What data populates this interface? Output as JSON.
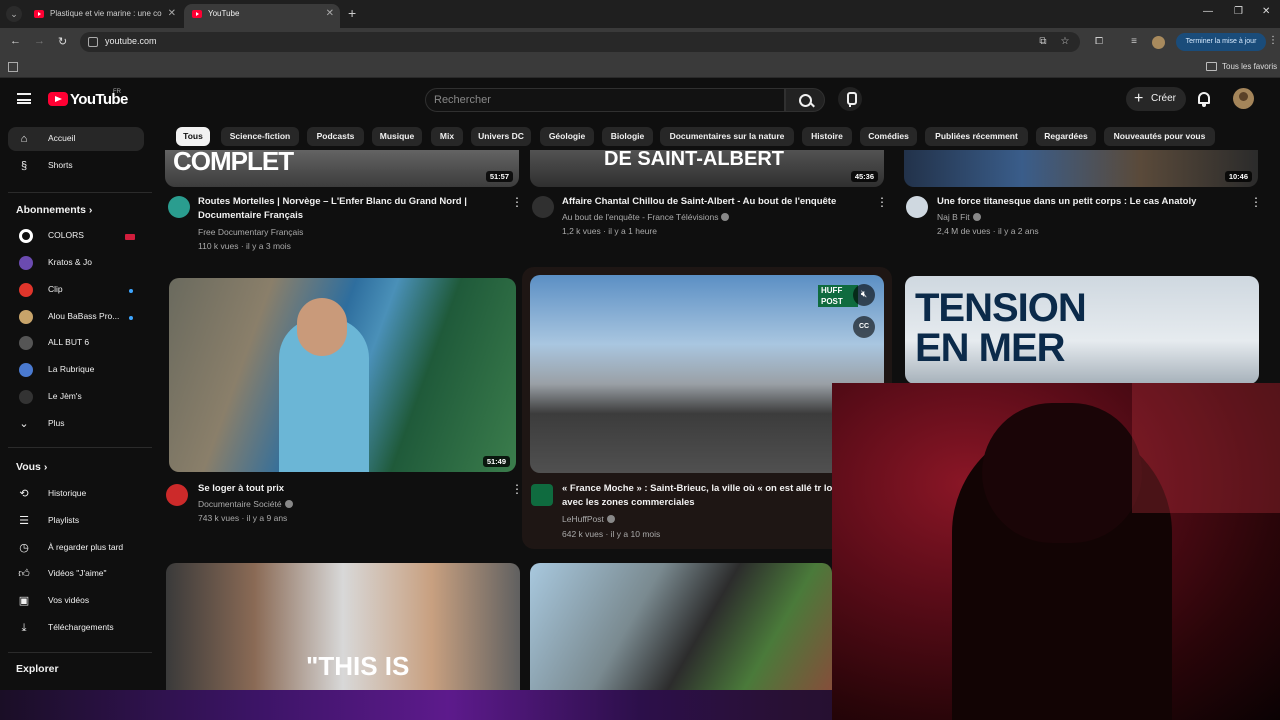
{
  "browser": {
    "tabs": [
      {
        "title": "Plastique et vie marine : une co"
      },
      {
        "title": "YouTube"
      }
    ],
    "url": "youtube.com",
    "update_button": "Terminer la mise à jour",
    "bookmarks_folder": "Tous les favoris"
  },
  "header": {
    "logo_text": "YouTube",
    "country": "FR",
    "search_placeholder": "Rechercher",
    "create_label": "Créer"
  },
  "chips": [
    "Tous",
    "Science-fiction",
    "Podcasts",
    "Musique",
    "Mix",
    "Univers DC",
    "Géologie",
    "Biologie",
    "Documentaires sur la nature",
    "Histoire",
    "Comédies",
    "Publiées récemment",
    "Regardées",
    "Nouveautés pour vous"
  ],
  "sidebar": {
    "main": [
      {
        "label": "Accueil",
        "icon": "home-icon"
      },
      {
        "label": "Shorts",
        "icon": "shorts-icon"
      }
    ],
    "subscriptions_title": "Abonnements",
    "subscriptions": [
      {
        "label": "COLORS",
        "color": "#ffffff"
      },
      {
        "label": "Kratos & Jo",
        "color": "#6b4bb0"
      },
      {
        "label": "Clip",
        "color": "#e0352b"
      },
      {
        "label": "Alou BaBass Pro...",
        "color": "#c8a46a"
      },
      {
        "label": "ALL BUT 6",
        "color": "#555555"
      },
      {
        "label": "La Rubrique",
        "color": "#4a7ad0"
      },
      {
        "label": "Le Jèm's",
        "color": "#333333"
      }
    ],
    "more_label": "Plus",
    "you_title": "Vous",
    "you_items": [
      {
        "label": "Historique",
        "icon": "history-icon"
      },
      {
        "label": "Playlists",
        "icon": "playlists-icon"
      },
      {
        "label": "À regarder plus tard",
        "icon": "watch-later-icon"
      },
      {
        "label": "Vidéos \"J'aime\"",
        "icon": "thumbs-up-icon"
      },
      {
        "label": "Vos vidéos",
        "icon": "your-videos-icon"
      },
      {
        "label": "Téléchargements",
        "icon": "download-icon"
      }
    ],
    "explore_title": "Explorer"
  },
  "videos": [
    {
      "title": "Routes Mortelles | Norvège – L'Enfer Blanc du Grand Nord | Documentaire Français",
      "channel": "Free Documentary Français",
      "meta": "110 k vues · il y a 3 mois",
      "duration": "51:57",
      "thumb_text": "COMPLET"
    },
    {
      "title": "Affaire Chantal Chillou de Saint-Albert - Au bout de l'enquête",
      "channel": "Au bout de l'enquête - France Télévisions",
      "meta": "1,2 k vues · il y a 1 heure",
      "duration": "45:36",
      "thumb_text": "DE SAINT-ALBERT"
    },
    {
      "title": "Une force titanesque dans un petit corps : Le cas Anatoly",
      "channel": "Naj B Fit",
      "meta": "2,4 M de vues · il y a 2 ans",
      "duration": "10:46"
    },
    {
      "title": "Se loger à tout prix",
      "channel": "Documentaire Société",
      "meta": "743 k vues · il y a 9 ans",
      "duration": "51:49"
    },
    {
      "title": "« France Moche » : Saint-Brieuc, la ville où « on est allé tr loin » avec les zones commerciales",
      "channel": "LeHuffPost",
      "meta": "642 k vues · il y a 10 mois",
      "thumb_text": "HUFF POST"
    },
    {
      "thumb_text": "TENSION EN MER"
    },
    {
      "thumb_text": "\"THIS IS"
    }
  ]
}
